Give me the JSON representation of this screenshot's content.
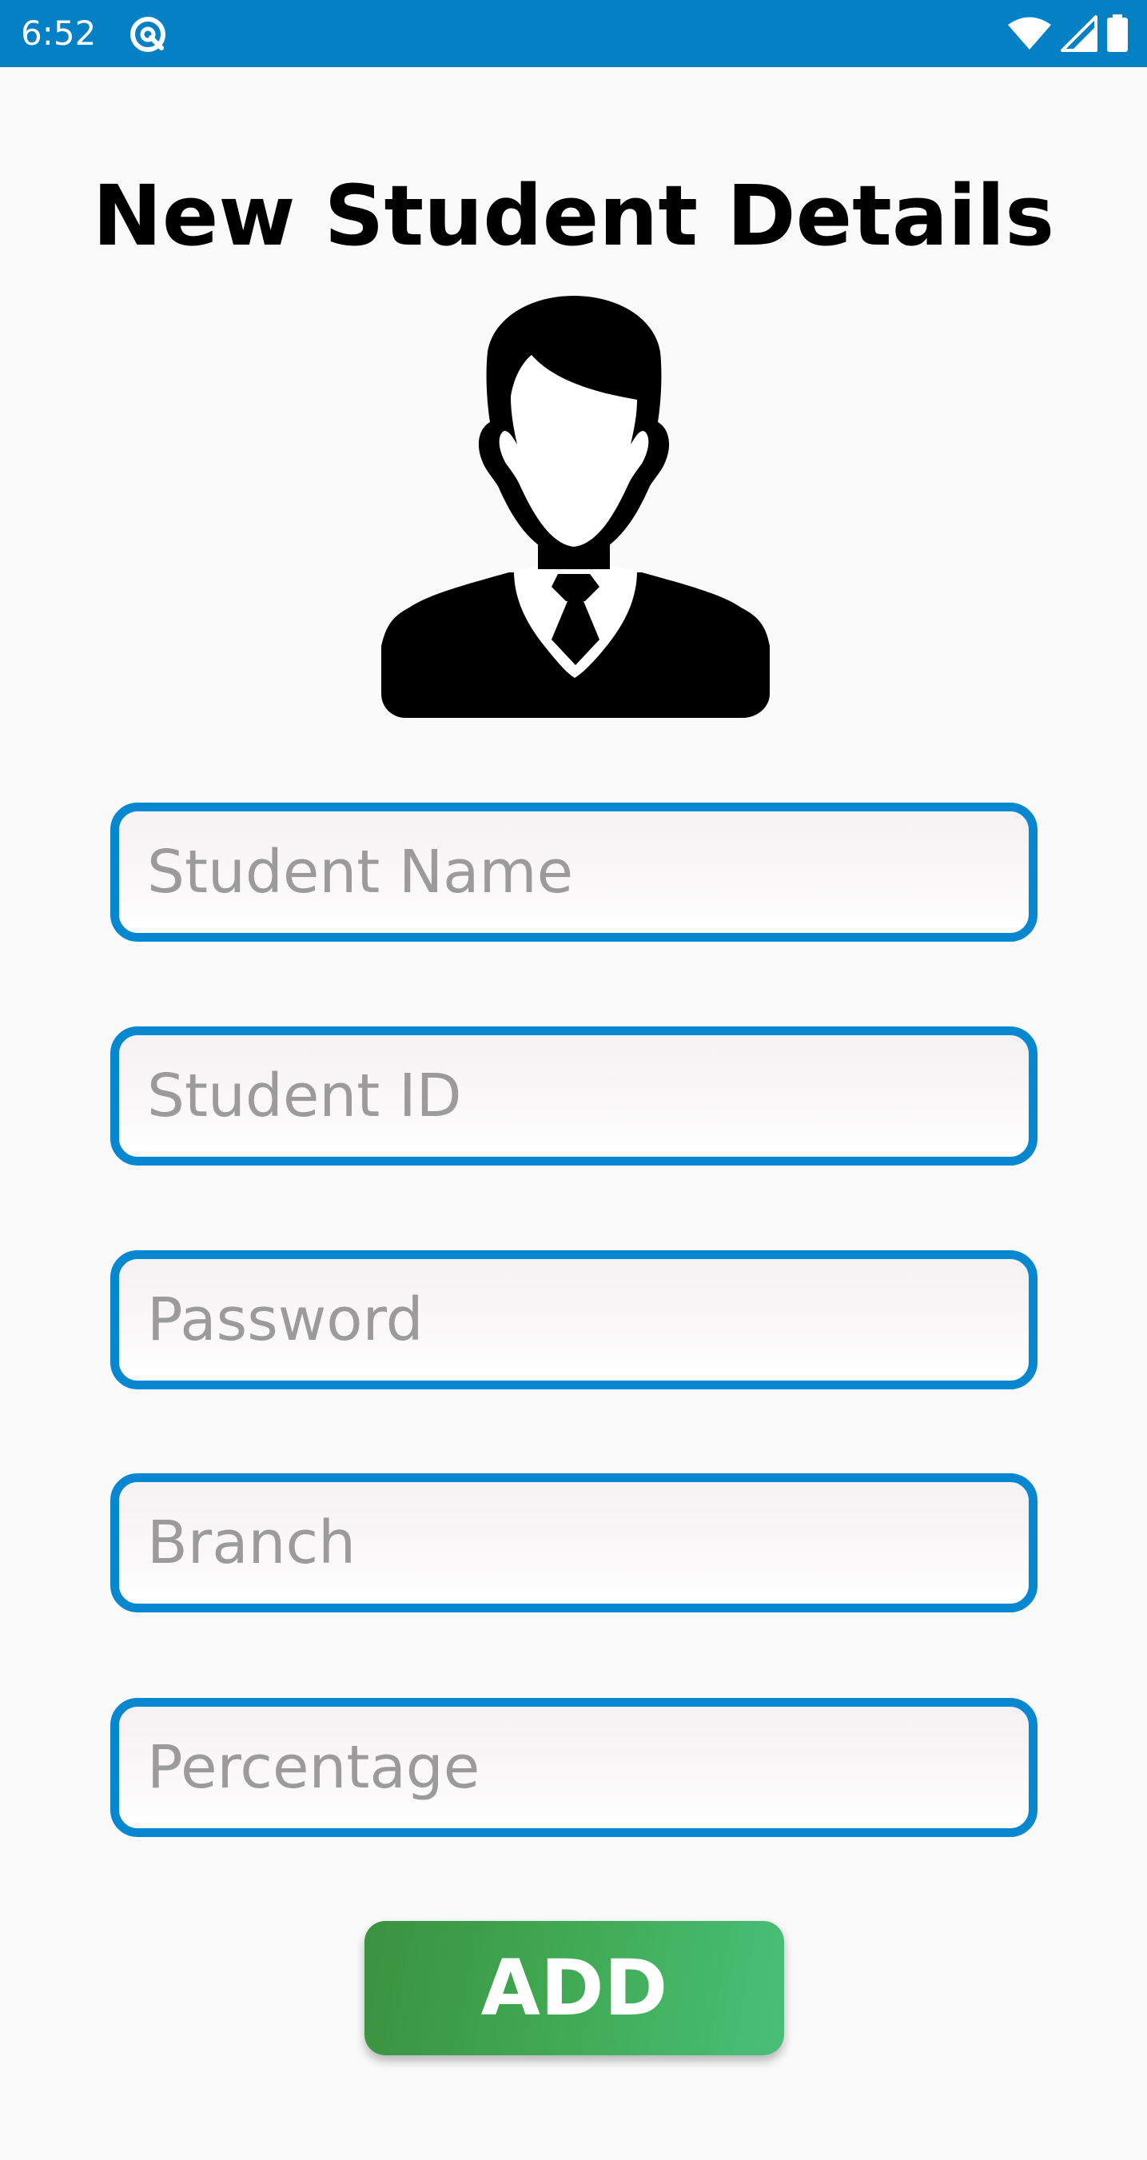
{
  "status_bar": {
    "time": "6:52",
    "background_color": "#0480c4",
    "icons": [
      "app-notification-icon",
      "wifi-icon",
      "signal-icon",
      "battery-icon"
    ]
  },
  "page": {
    "title": "New Student Details",
    "avatar_icon": "student-avatar-icon"
  },
  "form": {
    "fields": [
      {
        "placeholder": "Student Name",
        "value": ""
      },
      {
        "placeholder": "Student ID",
        "value": ""
      },
      {
        "placeholder": "Password",
        "value": ""
      },
      {
        "placeholder": "Branch",
        "value": ""
      },
      {
        "placeholder": "Percentage",
        "value": ""
      }
    ],
    "field_border_color": "#0887d1",
    "submit_label": "ADD",
    "submit_color": "#40a851"
  }
}
